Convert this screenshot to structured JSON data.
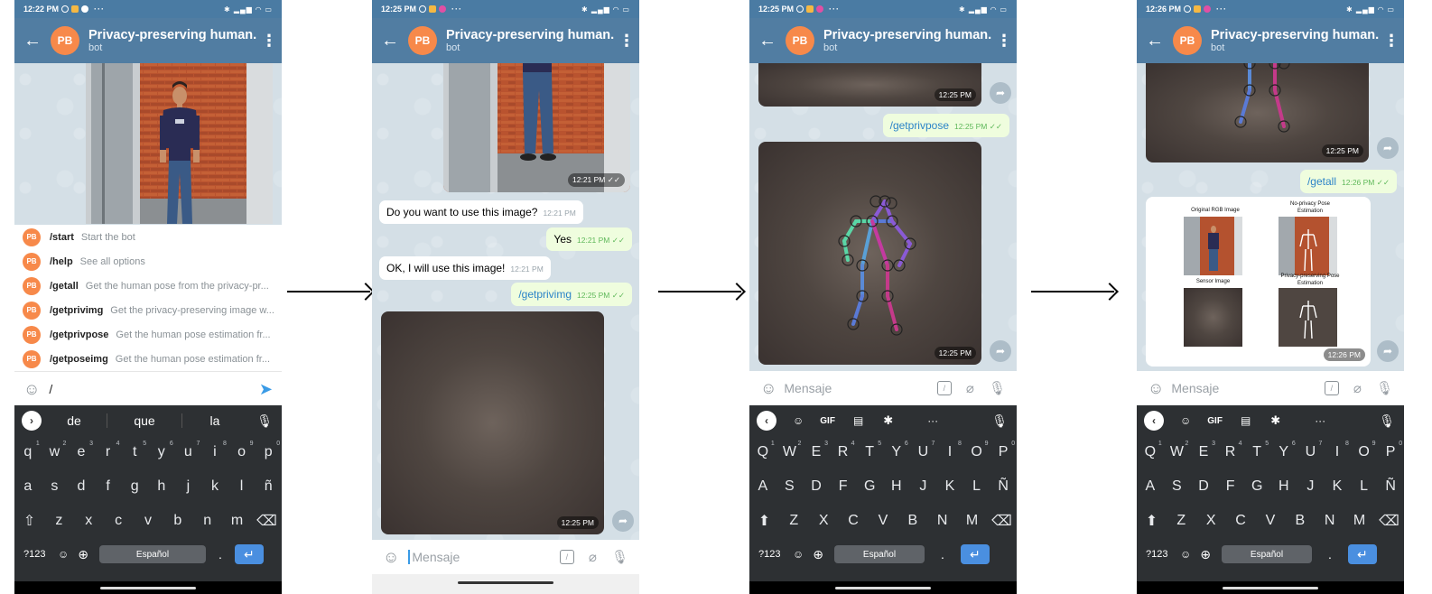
{
  "phones": [
    {
      "status_time": "12:22 PM",
      "title": "Privacy-preserving human...",
      "subtitle": "bot",
      "avatar": "PB",
      "commands": [
        {
          "cmd": "/start",
          "desc": "Start the bot"
        },
        {
          "cmd": "/help",
          "desc": "See all options"
        },
        {
          "cmd": "/getall",
          "desc": "Get the human pose from the privacy-pr..."
        },
        {
          "cmd": "/getprivimg",
          "desc": "Get the privacy-preserving image w..."
        },
        {
          "cmd": "/getprivpose",
          "desc": "Get the human pose estimation fr..."
        },
        {
          "cmd": "/getposeimg",
          "desc": "Get the human pose estimation fr..."
        }
      ],
      "input_value": "/",
      "suggestions": [
        "de",
        "que",
        "la"
      ],
      "keyboard_rows": [
        [
          "q",
          "w",
          "e",
          "r",
          "t",
          "y",
          "u",
          "i",
          "o",
          "p"
        ],
        [
          "a",
          "s",
          "d",
          "f",
          "g",
          "h",
          "j",
          "k",
          "l",
          "ñ"
        ],
        [
          "z",
          "x",
          "c",
          "v",
          "b",
          "n",
          "m"
        ]
      ],
      "key_numbers": [
        "1",
        "2",
        "3",
        "4",
        "5",
        "6",
        "7",
        "8",
        "9",
        "0"
      ],
      "sym_key": "?123",
      "space_label": "Español",
      "period": "."
    },
    {
      "status_time": "12:25 PM",
      "title": "Privacy-preserving human...",
      "subtitle": "bot",
      "avatar": "PB",
      "photo_time": "12:21 PM",
      "messages": [
        {
          "text": "Do you want to use this image?",
          "time": "12:21 PM",
          "dir": "in"
        },
        {
          "text": "Yes",
          "time": "12:21 PM",
          "dir": "out"
        },
        {
          "text": "OK, I will use this image!",
          "time": "12:21 PM",
          "dir": "in"
        },
        {
          "text": "/getprivimg",
          "time": "12:25 PM",
          "dir": "out"
        }
      ],
      "image_time": "12:25 PM",
      "input_placeholder": "Mensaje"
    },
    {
      "status_time": "12:25 PM",
      "title": "Privacy-preserving human...",
      "subtitle": "bot",
      "avatar": "PB",
      "top_image_time": "12:25 PM",
      "command": {
        "text": "/getprivpose",
        "time": "12:25 PM"
      },
      "pose_image_time": "12:25 PM",
      "input_placeholder": "Mensaje",
      "keyboard_rows": [
        [
          "Q",
          "W",
          "E",
          "R",
          "T",
          "Y",
          "U",
          "I",
          "O",
          "P"
        ],
        [
          "A",
          "S",
          "D",
          "F",
          "G",
          "H",
          "J",
          "K",
          "L",
          "Ñ"
        ],
        [
          "Z",
          "X",
          "C",
          "V",
          "B",
          "N",
          "M"
        ]
      ],
      "key_numbers": [
        "1",
        "2",
        "3",
        "4",
        "5",
        "6",
        "7",
        "8",
        "9",
        "0"
      ],
      "gif_label": "GIF",
      "sym_key": "?123",
      "space_label": "Español",
      "period": "."
    },
    {
      "status_time": "12:26 PM",
      "title": "Privacy-preserving human...",
      "subtitle": "bot",
      "avatar": "PB",
      "top_image_time": "12:25 PM",
      "command": {
        "text": "/getall",
        "time": "12:26 PM"
      },
      "panel_labels": {
        "original": "Original RGB Image",
        "no_privacy": "No-privacy Pose Estimation",
        "sensor": "Sensor Image",
        "privacy": "Privacy-preserving Pose Estimation"
      },
      "result_time": "12:26 PM",
      "input_placeholder": "Mensaje",
      "keyboard_rows": [
        [
          "Q",
          "W",
          "E",
          "R",
          "T",
          "Y",
          "U",
          "I",
          "O",
          "P"
        ],
        [
          "A",
          "S",
          "D",
          "F",
          "G",
          "H",
          "J",
          "K",
          "L",
          "Ñ"
        ],
        [
          "Z",
          "X",
          "C",
          "V",
          "B",
          "N",
          "M"
        ]
      ],
      "key_numbers": [
        "1",
        "2",
        "3",
        "4",
        "5",
        "6",
        "7",
        "8",
        "9",
        "0"
      ],
      "gif_label": "GIF",
      "sym_key": "?123",
      "space_label": "Español",
      "period": "."
    }
  ],
  "colors": {
    "header": "#517da2",
    "statusbar": "#4a7ba3",
    "avatar": "#f7894a",
    "keyboard": "#2d3033",
    "enter_key": "#4a8fe0",
    "outgoing_bubble": "#effdde",
    "link": "#2c84c8"
  }
}
